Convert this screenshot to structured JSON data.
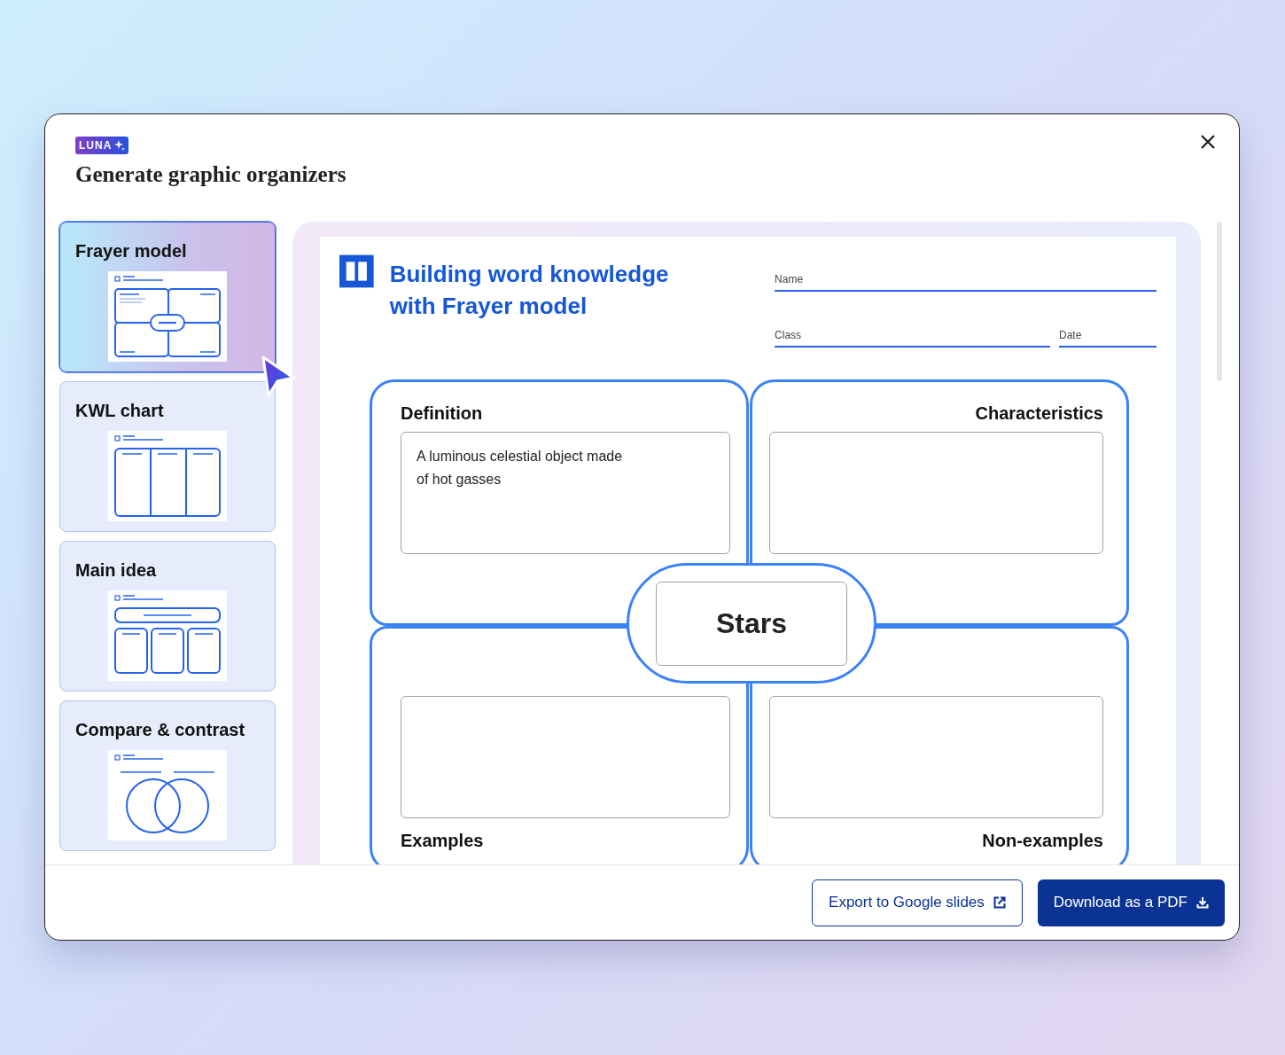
{
  "header": {
    "badge": "LUNA",
    "title": "Generate graphic organizers"
  },
  "sidebar": {
    "items": [
      {
        "label": "Frayer model",
        "kind": "frayer",
        "selected": true
      },
      {
        "label": "KWL chart",
        "kind": "kwl",
        "selected": false
      },
      {
        "label": "Main idea",
        "kind": "main_idea",
        "selected": false
      },
      {
        "label": "Compare & contrast",
        "kind": "compare",
        "selected": false
      }
    ]
  },
  "worksheet": {
    "title": "Building word knowledge with Frayer model",
    "fields": [
      {
        "label": "Name"
      },
      {
        "label": "Class"
      },
      {
        "label": "Date"
      }
    ],
    "frayer": {
      "word": "Stars",
      "quadrants": [
        {
          "label": "Definition",
          "answer": "A luminous celestial object made of hot gasses"
        },
        {
          "label": "Characteristics"
        },
        {
          "label": "Examples"
        },
        {
          "label": "Non-examples"
        }
      ]
    }
  },
  "footer": {
    "buttons": [
      {
        "label": "Export to Google slides",
        "kind": "secondary"
      },
      {
        "label": "Download as a PDF",
        "kind": "primary"
      }
    ]
  }
}
